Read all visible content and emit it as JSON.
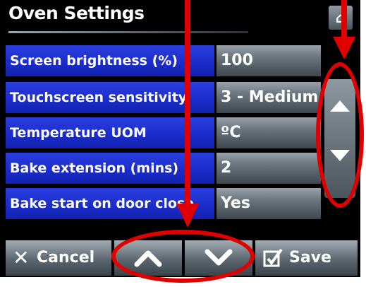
{
  "header": {
    "title": "Oven Settings",
    "home_icon": "home-icon"
  },
  "settings": [
    {
      "label": "Screen brightness (%)",
      "value": "100"
    },
    {
      "label": "Touchscreen sensitivity",
      "value": "3 - Medium"
    },
    {
      "label": "Temperature UOM",
      "value": "ºC"
    },
    {
      "label": "Bake extension (mins)",
      "value": "2"
    },
    {
      "label": "Bake start on door close",
      "value": "Yes"
    }
  ],
  "scrollbar": {
    "up_icon": "triangle-up-icon",
    "down_icon": "triangle-down-icon"
  },
  "footer": {
    "cancel_label": "Cancel",
    "save_label": "Save",
    "cancel_icon": "x-icon",
    "save_icon": "checkbox-check-icon",
    "up_icon": "chevron-up-icon",
    "down_icon": "chevron-down-icon"
  },
  "annotation": {
    "color": "#e00000"
  },
  "colors": {
    "label_bg": "#1a2bc8",
    "value_bg": "#6d7880",
    "screen_bg": "#000000"
  }
}
